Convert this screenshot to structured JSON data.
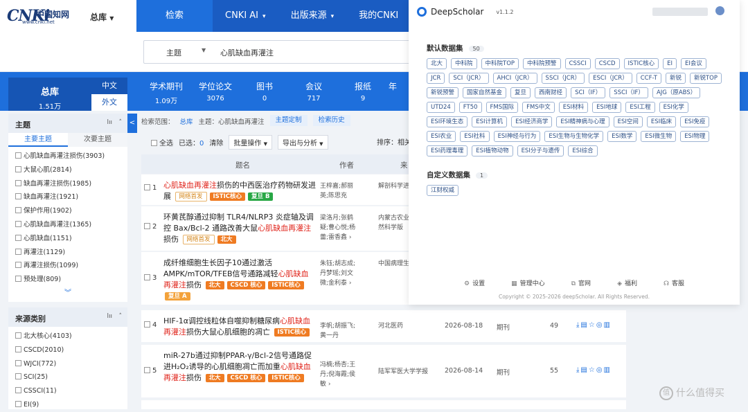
{
  "header": {
    "logo_big": "CNKi",
    "logo_cn": "中国知网",
    "logo_url": "www.cnki.net",
    "db_select": "总库",
    "nav": [
      {
        "label": "检索",
        "active": true
      },
      {
        "label": "CNKI AI",
        "dropdown": true
      },
      {
        "label": "出版来源",
        "dropdown": true
      },
      {
        "label": "我的CNKI",
        "dropdown": false
      }
    ]
  },
  "search": {
    "field": "主题",
    "query": "心肌缺血再灌注"
  },
  "db_band": {
    "main": {
      "label": "总库",
      "count": "1.51万"
    },
    "lang": [
      "中文",
      "外文"
    ],
    "tabs": [
      {
        "label": "学术期刊",
        "count": "1.09万"
      },
      {
        "label": "学位论文",
        "count": "3076"
      },
      {
        "label": "图书",
        "count": "0"
      },
      {
        "label": "会议",
        "count": "717"
      },
      {
        "label": "报纸",
        "count": "9"
      },
      {
        "label": "年",
        "count": ""
      }
    ]
  },
  "facets": {
    "topic": {
      "title": "主题",
      "subtabs": [
        "主要主题",
        "次要主题"
      ],
      "items": [
        "心肌缺血再灌注损伤(3903)",
        "大鼠心肌(2814)",
        "缺血再灌注损伤(1985)",
        "缺血再灌注(1921)",
        "保护作用(1902)",
        "心肌缺血再灌注(1365)",
        "心肌缺血(1151)",
        "再灌注(1129)",
        "再灌注损伤(1099)",
        "预处理(809)"
      ],
      "more": "︾"
    },
    "source": {
      "title": "来源类别",
      "items": [
        "北大核心(4103)",
        "CSCD(2010)",
        "WJCI(772)",
        "SCI(25)",
        "CSSCI(11)",
        "EI(9)"
      ]
    },
    "icon_sort": "lıı",
    "icon_collapse": "˄",
    "collapse_tab": "<"
  },
  "results": {
    "scope_label": "检索范围：",
    "scope_db": "总库",
    "scope_query": "主题：心肌缺血再灌注",
    "btn_custom": "主题定制",
    "btn_history": "检索历史",
    "select_all": "全选",
    "selected": "已选：",
    "selected_count": "0",
    "clear": "清除",
    "batch": "批量操作",
    "export": "导出与分析",
    "sort": "排序：相关",
    "columns": [
      "题名",
      "作者",
      "来"
    ],
    "rows": [
      {
        "num": "1",
        "title_pre": "",
        "hl": "心肌缺血再灌注",
        "title_post": "损伤的中西医治疗药物研发进展",
        "tags": [
          {
            "t": "网络首发",
            "c": "ol"
          },
          {
            "t": "ISTIC核心",
            "c": "o"
          },
          {
            "t": "复旦 B",
            "c": "g"
          }
        ],
        "authors": "王梓嘉;郝丽英;陈思充",
        "source": "解剖科学进",
        "date": "",
        "type": "",
        "cite": ""
      },
      {
        "num": "2",
        "title_pre": "环黄芪醇通过抑制 TLR4/NLRP3 炎症轴及调控 Bax/Bcl-2 通路改善大鼠",
        "hl": "心肌缺血再灌注",
        "title_post": "损伤",
        "tags": [
          {
            "t": "网络首发",
            "c": "ol"
          },
          {
            "t": "北大",
            "c": "o"
          }
        ],
        "authors": "梁洛月;张鹤疑;曹心悦;杨蕾;雷香鑫 ›",
        "source": "内蒙古农业(自然科学版",
        "date": "",
        "type": "",
        "cite": ""
      },
      {
        "num": "3",
        "title_pre": "成纤维细胞生长因子10通过激活AMPK/mTOR/TFEB信号通路减轻",
        "hl": "心肌缺血再灌注",
        "title_post": "损伤",
        "tags": [
          {
            "t": "北大",
            "c": "o"
          },
          {
            "t": "CSCD 核心",
            "c": "o"
          },
          {
            "t": "ISTIC核心",
            "c": "o"
          },
          {
            "t": "复旦 A",
            "c": "y"
          }
        ],
        "authors": "朱钰;胡志成;丹梦瑶;刘文微;金利泰 ›",
        "source": "中国病理生",
        "date": "",
        "type": "",
        "cite": ""
      },
      {
        "num": "4",
        "title_pre": "HIF-1α调控线粒体自噬抑制糖尿病",
        "hl": "心肌缺血再灌注",
        "title_post": "损伤大鼠心肌细胞的凋亡",
        "tags": [
          {
            "t": "ISTIC核心",
            "c": "o"
          }
        ],
        "authors": "李帆;胡振飞;黄一丹",
        "source": "河北医药",
        "date": "2026-08-18",
        "type": "期刊",
        "cite": "49"
      },
      {
        "num": "5",
        "title_pre": "miR-27b通过抑制PPAR-γ/Bcl-2信号通路促进H₂O₂诱导的心肌细胞凋亡而加重",
        "hl": "心肌缺血再灌注",
        "title_post": "损伤",
        "tags": [
          {
            "t": "北大",
            "c": "o"
          },
          {
            "t": "CSCD 核心",
            "c": "o"
          },
          {
            "t": "ISTIC核心",
            "c": "o"
          }
        ],
        "authors": "冯楠;杨杏;王丹;倪海霞;侯敏 ›",
        "source": "陆军军医大学学报",
        "date": "2026-08-14",
        "type": "期刊",
        "cite": "55"
      }
    ],
    "actions": "⤓▤☆◎▥"
  },
  "panel": {
    "name": "DeepScholar",
    "version": "v1.1.2",
    "default_title": "默认数据集",
    "default_count": "50",
    "default_chips": [
      "北大",
      "中科院",
      "中科院TOP",
      "中科院预警",
      "CSSCI",
      "CSCD",
      "ISTIC核心",
      "EI",
      "EI会议",
      "JCR",
      "SCI（JCR）",
      "AHCI（JCR）",
      "SSCI（JCR）",
      "ESCI（JCR）",
      "CCF-T",
      "新锐",
      "新锐TOP",
      "新锐预警",
      "国家自然基金",
      "复旦",
      "西南财经",
      "SCI（IF）",
      "SSCI（IF）",
      "AJG（原ABS）",
      "UTD24",
      "FT50",
      "FMS国际",
      "FMS中文",
      "ESI材料",
      "ESI地球",
      "ESI工程",
      "ESI化学",
      "ESI环境生态",
      "ESI计算机",
      "ESI经济商学",
      "ESI精神病与心理",
      "ESI空间",
      "ESI临床",
      "ESI免疫",
      "ESI农业",
      "ESI社科",
      "ESI神经与行为",
      "ESI生物与生物化学",
      "ESI数学",
      "ESI微生物",
      "ESI物理",
      "ESI药理毒理",
      "ESI植物动物",
      "ESI分子与遗传",
      "ESI综合"
    ],
    "custom_title": "自定义数据集",
    "custom_count": "1",
    "custom_chips": [
      "江财权威"
    ],
    "footer": [
      {
        "icon": "⚙",
        "label": "设置"
      },
      {
        "icon": "▦",
        "label": "管理中心"
      },
      {
        "icon": "⧉",
        "label": "官网"
      },
      {
        "icon": "◈",
        "label": "福利"
      },
      {
        "icon": "☊",
        "label": "客服"
      }
    ],
    "copyright": "Copyright © 2025-2026 deepScholar. All Rights Reserved."
  },
  "watermark": "什么值得买",
  "watermark_icon": "值"
}
